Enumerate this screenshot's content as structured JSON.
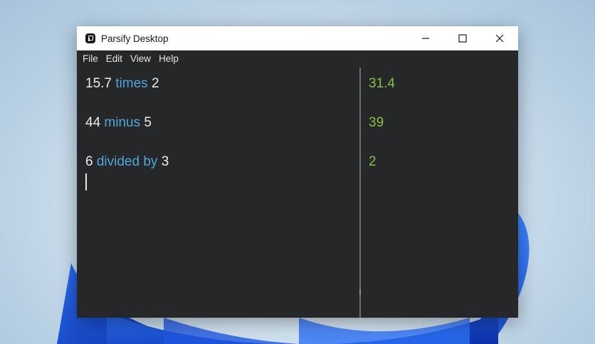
{
  "window": {
    "title": "Parsify Desktop"
  },
  "menu": {
    "items": [
      "File",
      "Edit",
      "View",
      "Help"
    ]
  },
  "editor": {
    "lines": [
      {
        "left": "15.7",
        "op": "times",
        "right": "2"
      },
      {
        "left": "44",
        "op": "minus",
        "right": "5"
      },
      {
        "left": "6",
        "op": "divided by",
        "right": "3"
      }
    ]
  },
  "results": [
    "31.4",
    "39",
    "2"
  ],
  "colors": {
    "number": "#ececec",
    "operator": "#4fa6d9",
    "result": "#86c23f",
    "background": "#262729"
  },
  "icons": {
    "app": "parsify-logo-icon",
    "minimize": "minimize-icon",
    "maximize": "maximize-icon",
    "close": "close-icon"
  }
}
